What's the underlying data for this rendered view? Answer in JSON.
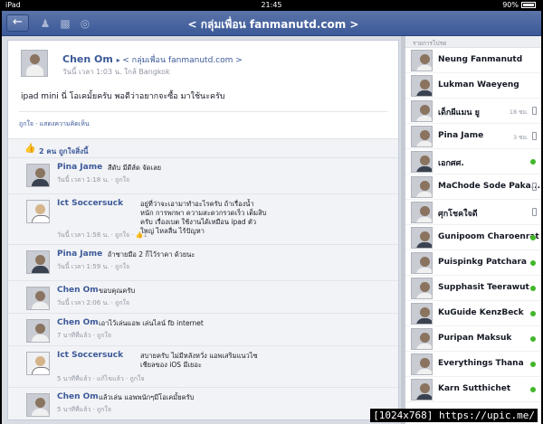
{
  "status": {
    "carrier": "iPad",
    "time": "21:45",
    "battery": "90%"
  },
  "nav": {
    "title": "< กลุ่มเพื่อน fanmanutd.com >"
  },
  "post": {
    "author": "Chen Om",
    "group": "< กลุ่มเพื่อน fanmanutd.com >",
    "meta": "วันนี้ เวลา 1:03 น. ใกล้ Bangkok",
    "text": "ipad mini นี่ โอเคมั้ยครับ พอดีว่าอยากจะซื้อ มาใช้นะครับ",
    "actions": "ถูกใจ · แสดงความคิดเห็น",
    "likes": "2 คน ถูกใจสิ่งนี้"
  },
  "comments": [
    {
      "author": "Pina Jame",
      "text": "สีดับ มีดีส์ด จัดเลย",
      "meta": "วันนี้ เวลา 1:18 น. · ถูกใจ",
      "avatar": "dark"
    },
    {
      "author": "Ict Soccersuck",
      "text": "อยู่ที่ว่าจะเอามาทำอะไรครับ ถ้าเรื่องน้ำหนัก การพกพา ความสะดวกรวดเร็ว เต็มสิบครับ เรื่องเบต ใช้งานได้เหมือน ipad ตัวใหญ่ ไหลลื่น ไร้ปัญหา",
      "meta": "วันนี้ เวลา 1:58 น. · ถูกใจ · 👍1",
      "avatar": "cartoon"
    },
    {
      "author": "Pina Jame",
      "text": "ถ้าซายมือ 2 ก็ไว้ราคา ด้วยนะ",
      "meta": "วันนี้ เวลา 1:59 น. · ถูกใจ",
      "avatar": "dark"
    },
    {
      "author": "Chen Om",
      "text": "ขอบคุณครับ",
      "meta": "วันนี้ เวลา 2:06 น. · ถูกใจ",
      "avatar": "light"
    },
    {
      "author": "Chen Om",
      "text": "เอาไว้เล่นแอพ เล่นไลน์ fb internet",
      "meta": "7 นาทีที่แล้ว · ถูกใจ",
      "avatar": "light"
    },
    {
      "author": "Ict Soccersuck",
      "text": "สบายครับ ไม่มีหลังหวั่ง แอพเสริมแนวไซเชียลของ iOS มีเยอะ",
      "meta": "5 นาทีที่แล้ว · แก้ไขแล้ว · ถูกใจ",
      "avatar": "cartoon"
    },
    {
      "author": "Chen Om",
      "text": "แล้วเล่น แอพพนักๆมีโอเคมั้ยครับ",
      "meta": "5 นาทีที่แล้ว · ถูกใจ",
      "avatar": "light"
    }
  ],
  "sidebar": {
    "header": "รายการโปรด",
    "friends": [
      {
        "name": "Neung Fanmanutd",
        "status": "none",
        "time": ""
      },
      {
        "name": "Lukman Waeyeng",
        "status": "none",
        "time": ""
      },
      {
        "name": "เด็กผีแมน ยู",
        "status": "mobile",
        "time": "18 ซม."
      },
      {
        "name": "Pina Jame",
        "status": "mobile",
        "time": "3 ซม."
      },
      {
        "name": "เอกศศ.",
        "status": "online",
        "time": ""
      },
      {
        "name": "MaChode Sode Paka...",
        "status": "mobile",
        "time": ""
      },
      {
        "name": "ศุกโชคใจดี",
        "status": "mobile",
        "time": ""
      },
      {
        "name": "Gunipoom Charoenrat",
        "status": "online",
        "time": ""
      },
      {
        "name": "Puispinkg Patchara",
        "status": "online",
        "time": ""
      },
      {
        "name": "Supphasit Teerawut",
        "status": "online",
        "time": ""
      },
      {
        "name": "KuGuide KenzBeck",
        "status": "online",
        "time": ""
      },
      {
        "name": "Puripan Maksuk",
        "status": "online",
        "time": ""
      },
      {
        "name": "Everythings Thana",
        "status": "online",
        "time": ""
      },
      {
        "name": "Karn Sutthichet",
        "status": "online",
        "time": ""
      }
    ]
  },
  "watermark": "[1024x768] https://upic.me/",
  "colors": {
    "brand": "#3b5998",
    "online": "#42b72a"
  }
}
